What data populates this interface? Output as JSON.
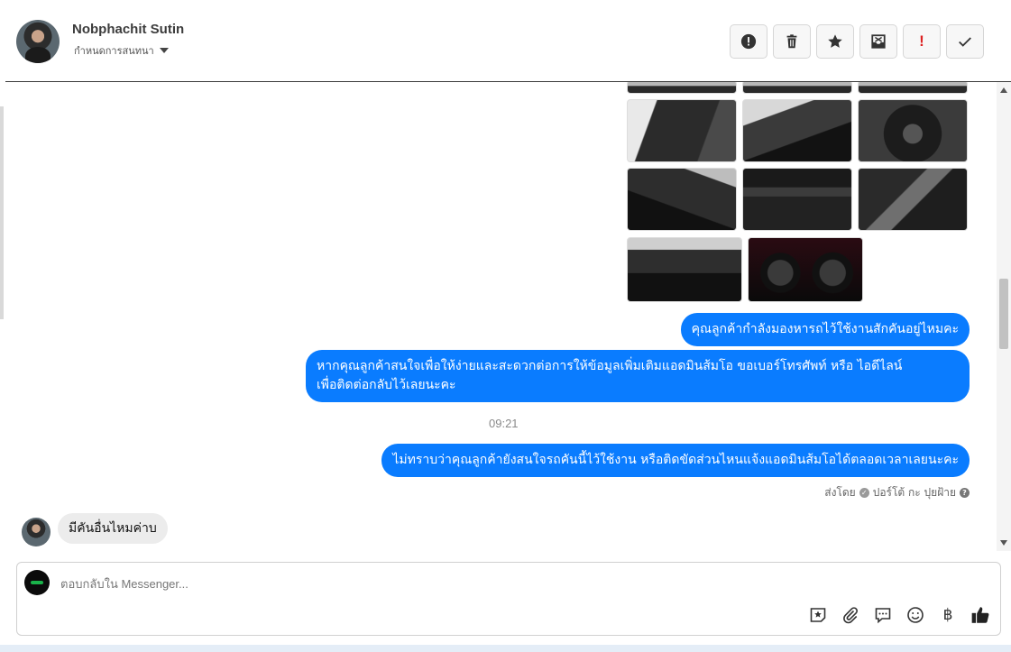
{
  "header": {
    "contact_name": "Nobphachit Sutin",
    "subtitle": "กำหนดการสนทนา",
    "actions": [
      {
        "name": "report-icon"
      },
      {
        "name": "trash-icon"
      },
      {
        "name": "star-icon"
      },
      {
        "name": "archive-icon"
      },
      {
        "name": "priority-icon",
        "label": "!"
      },
      {
        "name": "check-icon"
      }
    ]
  },
  "thread": {
    "messages_out": [
      {
        "text": "คุณลูกค้ากำลังมองหารถไว้ใช้งานสักคันอยู่ไหมคะ"
      },
      {
        "line1": "หากคุณลูกค้าสนใจเพื่อให้ง่ายและสะดวกต่อการให้ข้อมูลเพิ่มเติมแอดมินส้มโอ ขอเบอร์โทรศัพท์ หรือ ไอดีไลน์",
        "line2": "เพื่อติดต่อกลับไว้เลยนะคะ"
      },
      {
        "text": "ไม่ทราบว่าคุณลูกค้ายังสนใจรถคันนี้ไว้ใช้งาน หรือติดขัดส่วนไหนแจ้งแอดมินส้มโอได้ตลอดเวลาเลยนะคะ"
      }
    ],
    "timestamp": "09:21",
    "sent_by_label": "ส่งโดย",
    "sent_by_name": "ปอร์โต้ กะ ปุยฝ้าย",
    "message_in": "มีคันอื่นไหมค่าบ"
  },
  "composer": {
    "placeholder": "ตอบกลับใน Messenger...",
    "tools": [
      "sticker-icon",
      "attachment-icon",
      "saved-reply-icon",
      "emoji-icon",
      "baht-icon",
      "thumbs-up-icon"
    ],
    "baht_symbol": "฿"
  },
  "colors": {
    "bubble_out": "#0a7cff",
    "bubble_in": "#ececec",
    "priority": "#dd2222"
  }
}
